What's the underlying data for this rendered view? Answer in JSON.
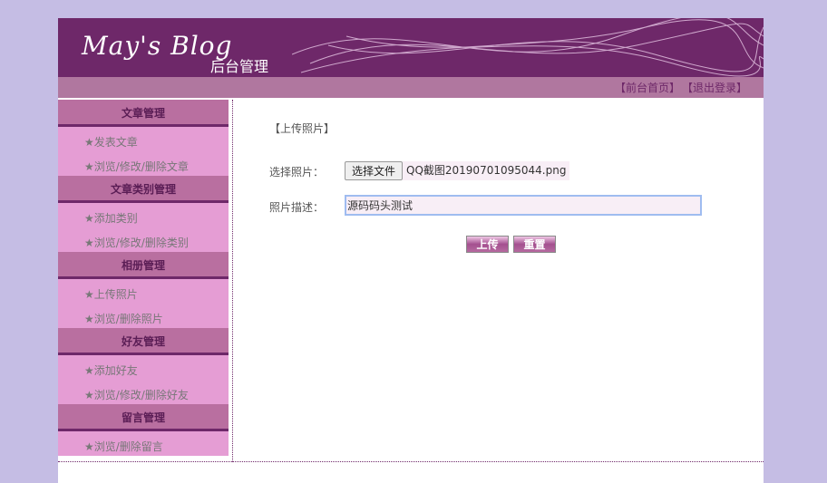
{
  "header": {
    "logo": "May's Blog",
    "subtitle": "后台管理"
  },
  "nav": {
    "home": "【前台首页】",
    "logout": "【退出登录】"
  },
  "sidebar": [
    {
      "title": "文章管理",
      "items": [
        "★发表文章",
        "★浏览/修改/删除文章"
      ]
    },
    {
      "title": "文章类别管理",
      "items": [
        "★添加类别",
        "★浏览/修改/删除类别"
      ]
    },
    {
      "title": "相册管理",
      "items": [
        "★上传照片",
        "★浏览/删除照片"
      ]
    },
    {
      "title": "好友管理",
      "items": [
        "★添加好友",
        "★浏览/修改/删除好友"
      ]
    },
    {
      "title": "留言管理",
      "items": [
        "★浏览/删除留言"
      ]
    }
  ],
  "form": {
    "title": "【上传照片】",
    "file_label": "选择照片：",
    "file_button": "选择文件",
    "file_name": "QQ截图20190701095044.png",
    "desc_label": "照片描述：",
    "desc_value": "源码码头测试",
    "submit": "上传",
    "reset": "重置"
  }
}
